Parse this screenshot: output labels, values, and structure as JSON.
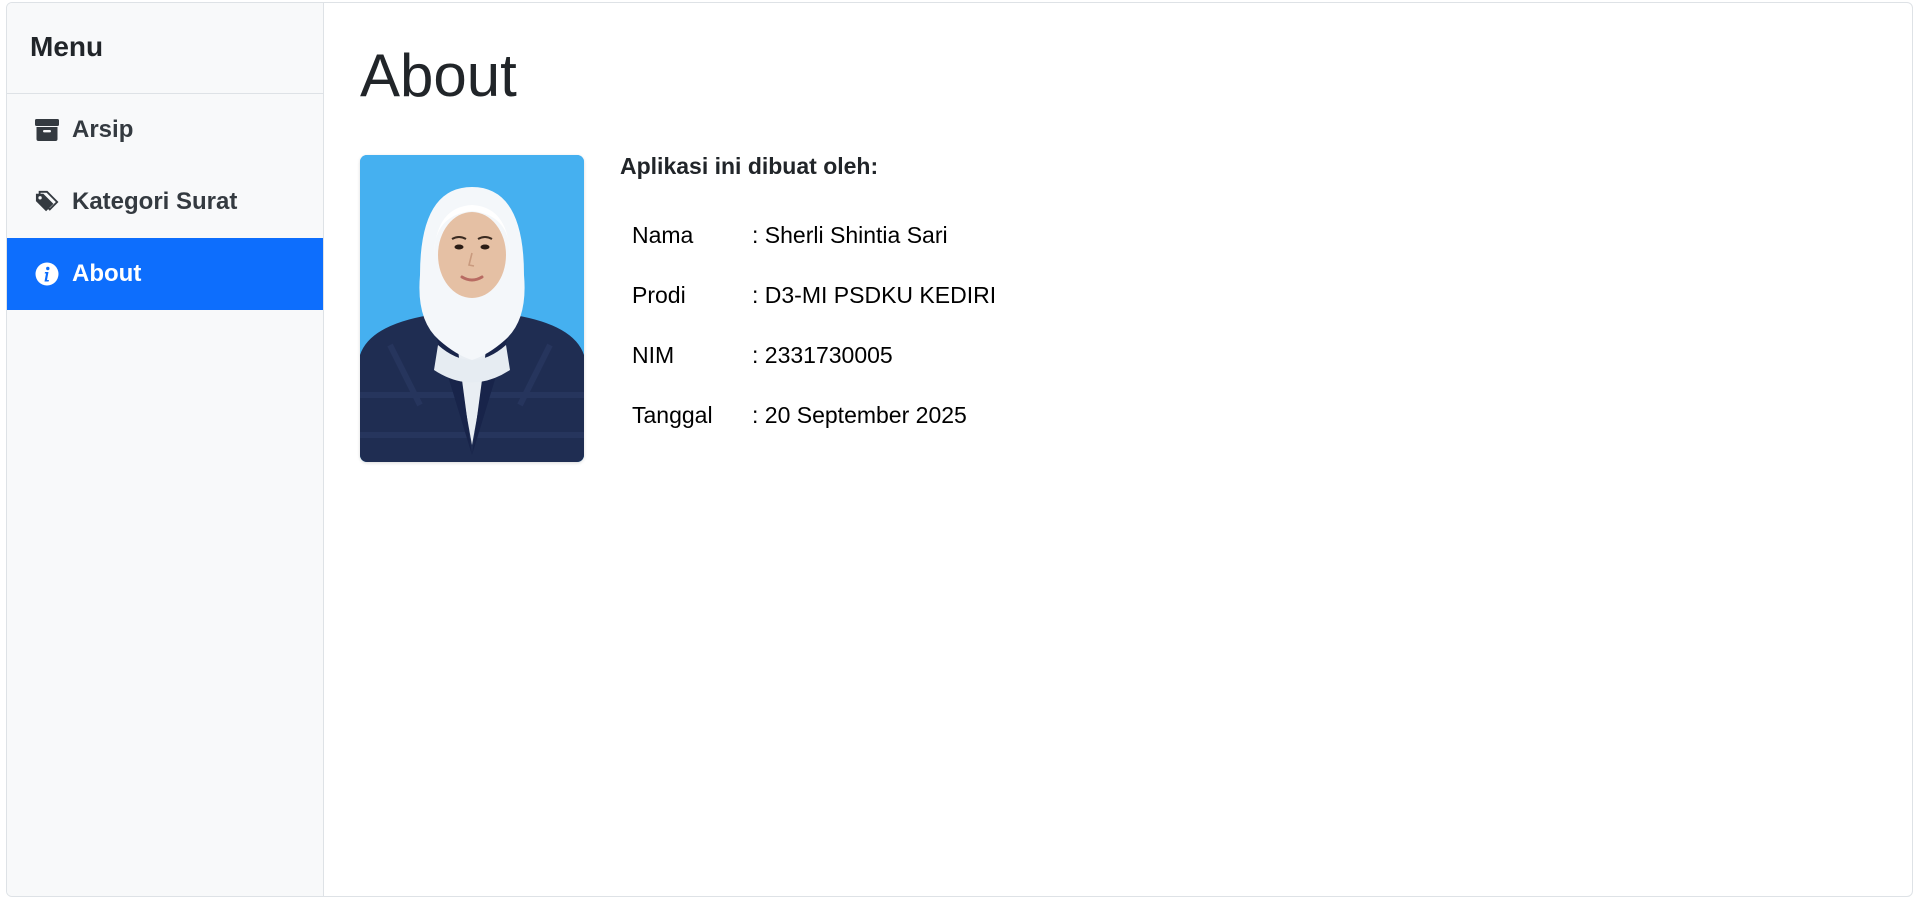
{
  "sidebar": {
    "title": "Menu",
    "items": [
      {
        "label": "Arsip",
        "icon": "archive-icon",
        "active": false
      },
      {
        "label": "Kategori Surat",
        "icon": "tag-icon",
        "active": false
      },
      {
        "label": "About",
        "icon": "info-icon",
        "active": true
      }
    ]
  },
  "main": {
    "title": "About",
    "heading": "Aplikasi ini dibuat oleh:",
    "rows": [
      {
        "label": "Nama",
        "value": ": Sherli Shintia Sari"
      },
      {
        "label": "Prodi",
        "value": ": D3-MI PSDKU KEDIRI"
      },
      {
        "label": "NIM",
        "value": ": 2331730005"
      },
      {
        "label": "Tanggal",
        "value": ": 20 September 2025"
      }
    ]
  },
  "colors": {
    "accent": "#0d6efd",
    "sidebar_bg": "#f8f9fa",
    "photo_bg": "#45b0f0"
  }
}
